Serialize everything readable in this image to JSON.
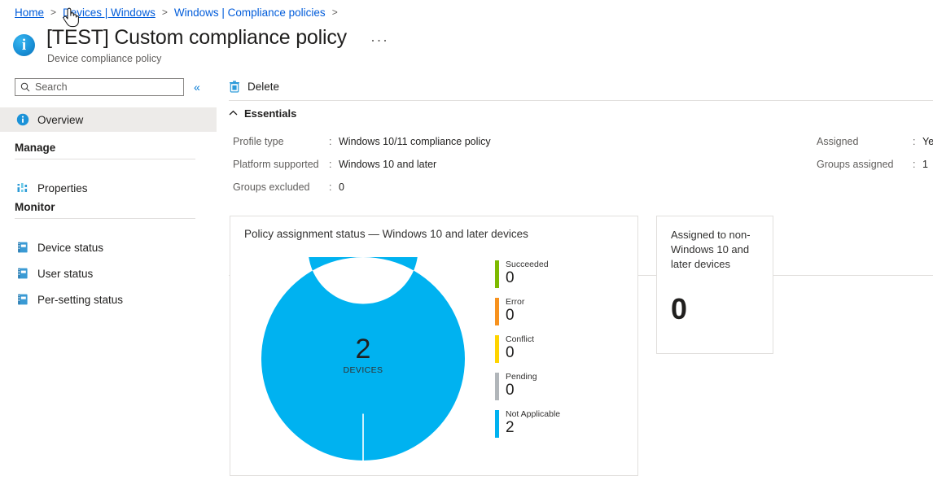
{
  "breadcrumb": {
    "items": [
      {
        "label": "Home",
        "hovered": false
      },
      {
        "label": "Devices | Windows",
        "hovered": true
      },
      {
        "label": "Windows | Compliance policies",
        "hovered": false
      }
    ],
    "separator": ">"
  },
  "header": {
    "icon": "info-circle-icon",
    "title": "[TEST] Custom compliance policy",
    "subtitle": "Device compliance policy",
    "more_label": "···"
  },
  "sidebar": {
    "search": {
      "placeholder": "Search",
      "value": "",
      "icon": "search-icon"
    },
    "collapse_label": "«",
    "top_items": [
      {
        "label": "Overview",
        "icon": "info-circle-icon",
        "selected": true
      }
    ],
    "groups": [
      {
        "title": "Manage",
        "items": [
          {
            "label": "Properties",
            "icon": "sliders-icon",
            "selected": false
          }
        ]
      },
      {
        "title": "Monitor",
        "items": [
          {
            "label": "Device status",
            "icon": "report-icon",
            "selected": false
          },
          {
            "label": "User status",
            "icon": "report-icon",
            "selected": false
          },
          {
            "label": "Per-setting status",
            "icon": "report-icon",
            "selected": false
          }
        ]
      }
    ]
  },
  "command_bar": {
    "delete_label": "Delete",
    "delete_icon": "trash-icon"
  },
  "essentials": {
    "title": "Essentials",
    "chevron_icon": "chevron-up-icon",
    "left": [
      {
        "key": "Profile type",
        "value": "Windows 10/11 compliance policy"
      },
      {
        "key": "Platform supported",
        "value": "Windows 10 and later"
      },
      {
        "key": "Groups excluded",
        "value": "0"
      }
    ],
    "right": [
      {
        "key": "Assigned",
        "value": "Yes"
      },
      {
        "key": "Groups assigned",
        "value": "1"
      }
    ],
    "colon": ":"
  },
  "non_windows_card": {
    "title": "Assigned to non-Windows 10 and later devices",
    "value": "0"
  },
  "chart_data": {
    "type": "pie",
    "title": "Policy assignment status — Windows 10 and later devices",
    "center_value": "2",
    "center_label": "DEVICES",
    "categories": [
      "Succeeded",
      "Error",
      "Conflict",
      "Pending",
      "Not Applicable"
    ],
    "values": [
      0,
      0,
      0,
      0,
      2
    ],
    "colors": [
      "#7EBA00",
      "#F7921E",
      "#FFD400",
      "#B1B6BA",
      "#00B2F0"
    ],
    "total": 2,
    "legend_position": "right",
    "donut_hole_ratio": 0.54
  },
  "colors": {
    "accent": "#0078d4",
    "link": "#015cda",
    "cyan": "#00B2F0",
    "selected_row": "#edebe9",
    "border": "#e1dfdd"
  }
}
